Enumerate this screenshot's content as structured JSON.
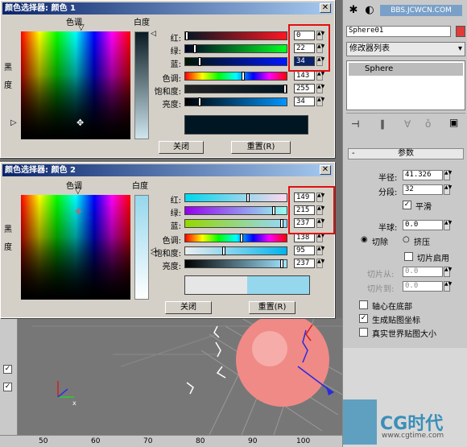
{
  "viewport": {
    "ruler": [
      "50",
      "60",
      "70",
      "80",
      "90",
      "100"
    ]
  },
  "command_panel": {
    "url": "BBS.JCWCN.COM",
    "object_name": "Sphere01",
    "modifier_list": "修改器列表",
    "stack_item": "Sphere",
    "rollout_title": "参数",
    "radius_label": "半径:",
    "radius_value": "41.326",
    "segments_label": "分段:",
    "segments_value": "32",
    "smooth_label": "平滑",
    "hemisphere_label": "半球:",
    "hemisphere_value": "0.0",
    "chop_label": "切除",
    "squash_label": "挤压",
    "slice_on_label": "切片启用",
    "slice_from_label": "切片从:",
    "slice_from_value": "0.0",
    "slice_to_label": "切片到:",
    "slice_to_value": "0.0",
    "base_pivot_label": "轴心在底部",
    "gen_map_label": "生成贴图坐标",
    "real_world_label": "真实世界贴图大小",
    "smooth_checked": true,
    "chop_selected": true,
    "gen_map_checked": true
  },
  "dialog1": {
    "title": "颜色选择器: 颜色 1",
    "hue_label": "色调",
    "whiteness_label": "白度",
    "black_label": "黑",
    "degree_label": "度",
    "red_label": "红:",
    "green_label": "绿:",
    "blue_label": "蓝:",
    "hue2_label": "色调:",
    "sat_label": "饱和度:",
    "val_label": "亮度:",
    "red_value": "0",
    "green_value": "22",
    "blue_value": "34",
    "hue_value": "143",
    "sat_value": "255",
    "val_value": "34",
    "close_label": "关闭",
    "reset_label": "重置(R)"
  },
  "dialog2": {
    "title": "颜色选择器: 颜色 2",
    "hue_label": "色调",
    "whiteness_label": "白度",
    "black_label": "黑",
    "degree_label": "度",
    "red_label": "红:",
    "green_label": "绿:",
    "blue_label": "蓝:",
    "hue2_label": "色调:",
    "sat_label": "饱和度:",
    "val_label": "亮度:",
    "red_value": "149",
    "green_value": "215",
    "blue_value": "237",
    "hue_value": "138",
    "sat_value": "95",
    "val_value": "237",
    "close_label": "关闭",
    "reset_label": "重置(R)"
  },
  "watermark": {
    "brand": "CG时代",
    "url": "www.cgtime.com"
  },
  "colors": {
    "color1": "#001622",
    "color2": "#95d7ed",
    "highlight": "#e01010"
  }
}
